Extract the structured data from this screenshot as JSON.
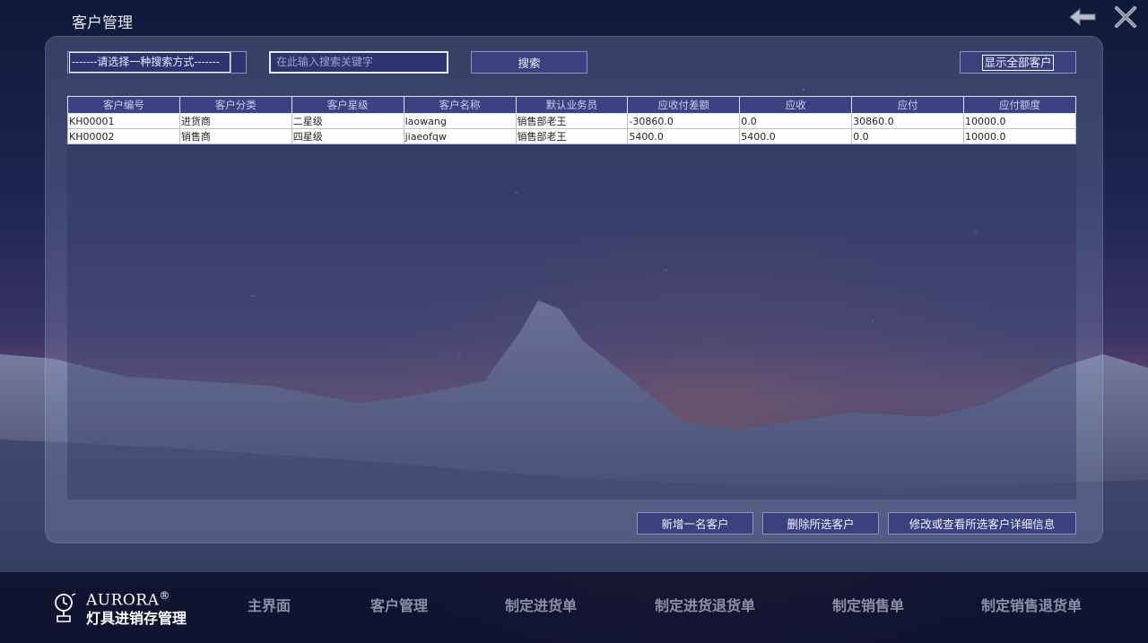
{
  "window": {
    "title": "客户管理"
  },
  "toolbar": {
    "search_mode": "-------请选择一种搜索方式-------",
    "search_placeholder": "在此输入搜索关键字",
    "search_button": "搜索",
    "show_all_button": "显示全部客户"
  },
  "table": {
    "columns": [
      "客户编号",
      "客户分类",
      "客户星级",
      "客户名称",
      "默认业务员",
      "应收付差额",
      "应收",
      "应付",
      "应付额度"
    ],
    "rows": [
      [
        "KH00001",
        "进货商",
        "二星级",
        "laowang",
        "销售部老王",
        "-30860.0",
        "0.0",
        "30860.0",
        "10000.0"
      ],
      [
        "KH00002",
        "销售商",
        "四星级",
        "jiaeofqw",
        "销售部老王",
        "5400.0",
        "5400.0",
        "0.0",
        "10000.0"
      ]
    ]
  },
  "actions": {
    "add": "新增一名客户",
    "delete": "删除所选客户",
    "edit": "修改或查看所选客户详细信息"
  },
  "footer": {
    "brand": "AURORA",
    "brand_mark": "®",
    "subtitle": "灯具进销存管理",
    "nav": [
      "主界面",
      "客户管理",
      "制定进货单",
      "制定进货退货单",
      "制定销售单",
      "制定销售退货单"
    ]
  },
  "icons": {
    "back": "back-arrow-icon",
    "close": "close-icon",
    "logo": "lamp-logo-icon"
  }
}
